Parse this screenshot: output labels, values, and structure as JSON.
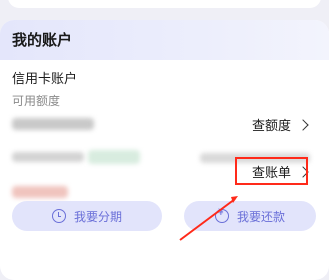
{
  "card": {
    "title": "我的账户",
    "section_title": "信用卡账户",
    "available_limit_label": "可用额度"
  },
  "links": {
    "check_limit": "查额度",
    "check_bill": "查账单"
  },
  "buttons": {
    "installment": "我要分期",
    "repay": "我要还款"
  },
  "colors": {
    "accent": "#6a6fd8",
    "highlight": "#ff2a1a",
    "pill_bg": "#e2e4fb"
  },
  "icons": {
    "installment": "clock-icon",
    "repay": "yen-icon"
  }
}
